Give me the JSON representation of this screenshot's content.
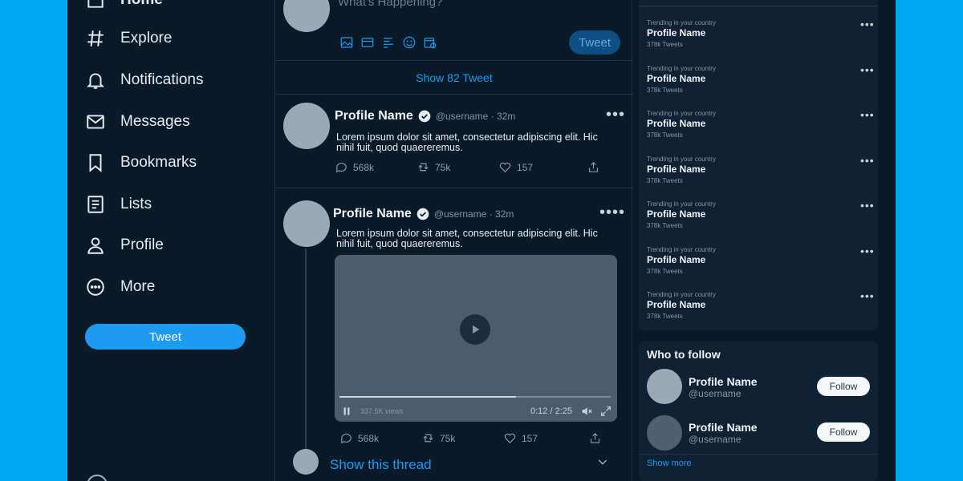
{
  "nav": {
    "home": "Home",
    "items": [
      {
        "label": "Explore",
        "icon": "hashtag-icon"
      },
      {
        "label": "Notifications",
        "icon": "bell-icon"
      },
      {
        "label": "Messages",
        "icon": "mail-icon"
      },
      {
        "label": "Bookmarks",
        "icon": "bookmark-icon"
      },
      {
        "label": "Lists",
        "icon": "list-icon"
      },
      {
        "label": "Profile",
        "icon": "user-icon"
      },
      {
        "label": "More",
        "icon": "more-circle-icon"
      }
    ],
    "tweet_button": "Tweet"
  },
  "compose": {
    "placeholder": "What's Happening?",
    "tweet_button": "Tweet"
  },
  "feed": {
    "show_new": "Show 82 Tweet",
    "tweets": [
      {
        "name": "Profile Name",
        "handle": "@username · 32m",
        "text": "Lorem ipsum dolor sit amet, consectetur adipiscing elit. Hic nihil fuit, quod quaereremus.",
        "replies": "568k",
        "retweets": "75k",
        "likes": "157"
      },
      {
        "name": "Profile Name",
        "handle": "@username · 32m",
        "text": "Lorem ipsum dolor sit amet, consectetur adipiscing elit. Hic nihil fuit, quod quaereremus.",
        "replies": "568k",
        "retweets": "75k",
        "likes": "157",
        "video": {
          "views": "337.5K views",
          "time": "0:12 / 2:25",
          "progress": 0.65
        },
        "show_thread": "Show this thread"
      }
    ]
  },
  "trends": [
    {
      "category": "Trending in your country",
      "name": "Profile Name",
      "count": "378k Tweets"
    },
    {
      "category": "Trending in your country",
      "name": "Profile Name",
      "count": "378k Tweets"
    },
    {
      "category": "Trending in your country",
      "name": "Profile Name",
      "count": "378k Tweets"
    },
    {
      "category": "Trending in your country",
      "name": "Profile Name",
      "count": "378k Tweets"
    },
    {
      "category": "Trending in your country",
      "name": "Profile Name",
      "count": "378k Tweets"
    },
    {
      "category": "Trending in your country",
      "name": "Profile Name",
      "count": "378k Tweets"
    },
    {
      "category": "Trending in your country",
      "name": "Profile Name",
      "count": "378k Tweets"
    }
  ],
  "who_to_follow": {
    "title": "Who to follow",
    "users": [
      {
        "name": "Profile Name",
        "handle": "@username",
        "button": "Follow"
      },
      {
        "name": "Profile Name",
        "handle": "@username",
        "button": "Follow"
      }
    ],
    "show_more": "Show more"
  },
  "colors": {
    "background": "#00aaf0",
    "panel": "#0b1a28",
    "accent": "#1d9bf0"
  }
}
